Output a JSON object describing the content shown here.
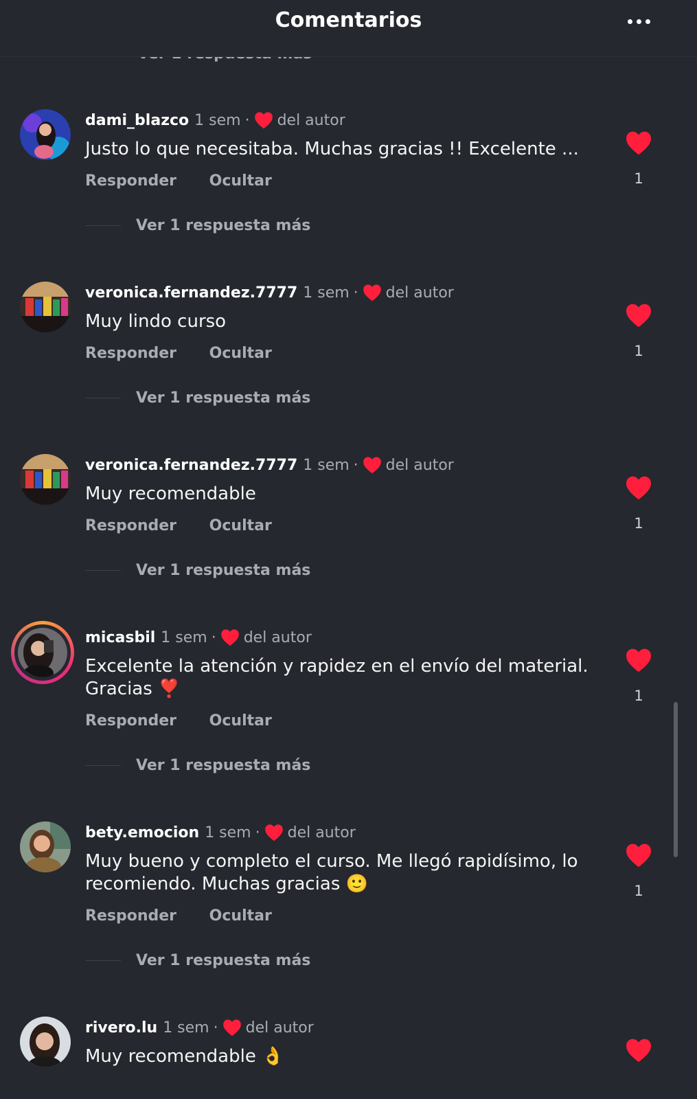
{
  "header": {
    "title": "Comentarios"
  },
  "peek_text": "Ver 1 respuesta más",
  "labels": {
    "reply": "Responder",
    "hide": "Ocultar",
    "by_author": "del autor",
    "more_replies": "Ver 1 respuesta más"
  },
  "comments": [
    {
      "username": "dami_blazco",
      "time": "1 sem",
      "text": "Justo lo que necesitaba. Muchas gracias !! Excelente ...",
      "likes": "1"
    },
    {
      "username": "veronica.fernandez.7777",
      "time": "1 sem",
      "text": "Muy lindo curso",
      "likes": "1"
    },
    {
      "username": "veronica.fernandez.7777",
      "time": "1 sem",
      "text": "Muy recomendable",
      "likes": "1"
    },
    {
      "username": "micasbil",
      "time": "1 sem",
      "text": "Excelente la atención y rapidez en el envío del material. Gracias ❣️",
      "likes": "1"
    },
    {
      "username": "bety.emocion",
      "time": "1 sem",
      "text": "Muy bueno y completo el curso. Me llegó rapidísimo, lo recomiendo. Muchas gracias 🙂",
      "likes": "1"
    },
    {
      "username": "rivero.lu",
      "time": "1 sem",
      "text": "Muy recomendable 👌",
      "likes": ""
    }
  ],
  "colors": {
    "background": "#25282e",
    "heart": "#ff1f3d",
    "muted": "#a8adb4"
  }
}
